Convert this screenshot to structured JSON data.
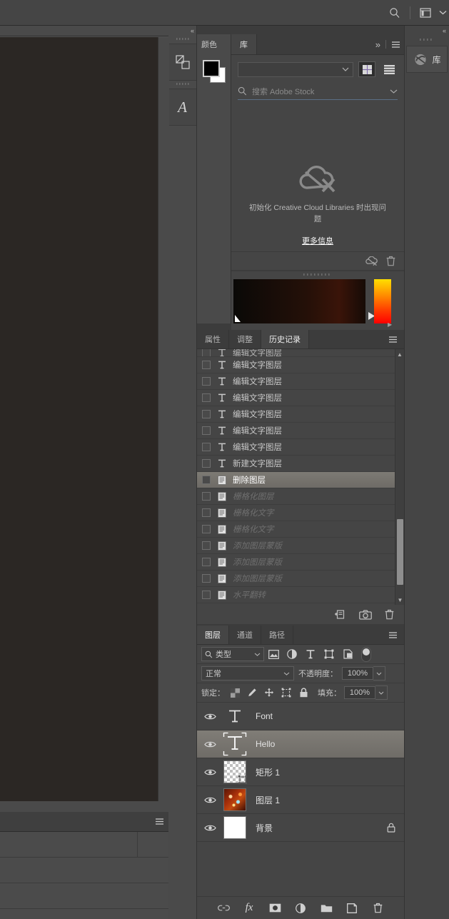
{
  "topbar": {
    "search_icon": "search-icon",
    "workspace_icon": "workspace-switcher-icon",
    "chevron": "chevron-down-icon"
  },
  "left_dock": {
    "collapse_label": "«",
    "items": [
      {
        "icon": "layer-comps-icon",
        "name": "layer-comps"
      },
      {
        "icon": "character-panel-icon",
        "name": "character-panel"
      }
    ]
  },
  "color_panel": {
    "tab_label": "颜色",
    "foreground": "#000000",
    "background": "#ffffff"
  },
  "libraries": {
    "tab_label": "库",
    "overflow_label": "»",
    "menu_icon": "panel-menu-icon",
    "dropdown_value": "",
    "grid_view_icon": "grid-view-icon",
    "list_view_icon": "list-view-icon",
    "search_placeholder": "搜索 Adobe Stock",
    "search_value": "",
    "error_icon": "cloud-error-icon",
    "error_message": "初始化 Creative Cloud Libraries 时出现问题",
    "more_info_label": "更多信息",
    "footer_icons": [
      "cloud-sync-error-icon",
      "trash-icon"
    ]
  },
  "color_picker": {
    "field_label": "color-field",
    "hue_label": "hue-slider",
    "play_icon": "play-icon"
  },
  "history": {
    "tabs": [
      {
        "label": "属性",
        "active": false
      },
      {
        "label": "调整",
        "active": false
      },
      {
        "label": "历史记录",
        "active": true
      }
    ],
    "menu_icon": "panel-menu-icon",
    "items": [
      {
        "label": "编辑文字图层",
        "icon": "text-icon",
        "state": "partial"
      },
      {
        "label": "编辑文字图层",
        "icon": "text-icon",
        "state": "normal"
      },
      {
        "label": "编辑文字图层",
        "icon": "text-icon",
        "state": "normal"
      },
      {
        "label": "编辑文字图层",
        "icon": "text-icon",
        "state": "normal"
      },
      {
        "label": "编辑文字图层",
        "icon": "text-icon",
        "state": "normal"
      },
      {
        "label": "编辑文字图层",
        "icon": "text-icon",
        "state": "normal"
      },
      {
        "label": "编辑文字图层",
        "icon": "text-icon",
        "state": "normal"
      },
      {
        "label": "新建文字图层",
        "icon": "text-icon",
        "state": "normal"
      },
      {
        "label": "删除图层",
        "icon": "doc-icon",
        "state": "selected"
      },
      {
        "label": "栅格化图层",
        "icon": "doc-icon",
        "state": "dim"
      },
      {
        "label": "栅格化文字",
        "icon": "doc-icon",
        "state": "dim"
      },
      {
        "label": "栅格化文字",
        "icon": "doc-icon",
        "state": "dim"
      },
      {
        "label": "添加图层蒙版",
        "icon": "doc-icon",
        "state": "dim"
      },
      {
        "label": "添加图层蒙版",
        "icon": "doc-icon",
        "state": "dim"
      },
      {
        "label": "添加图层蒙版",
        "icon": "doc-icon",
        "state": "dim"
      },
      {
        "label": "水平翻转",
        "icon": "doc-icon",
        "state": "dim"
      }
    ],
    "footer_icons": [
      "new-document-from-state-icon",
      "new-snapshot-icon",
      "delete-state-icon"
    ]
  },
  "layers": {
    "tabs": [
      {
        "label": "图层",
        "active": true
      },
      {
        "label": "通道",
        "active": false
      },
      {
        "label": "路径",
        "active": false
      }
    ],
    "menu_icon": "panel-menu-icon",
    "filter": {
      "search_icon": "search-icon",
      "kind_label": "类型",
      "chevron": "chevron-down-icon",
      "icons": [
        "filter-pixel-icon",
        "filter-adjustment-icon",
        "filter-type-icon",
        "filter-shape-icon",
        "filter-smartobject-icon"
      ],
      "toggle": "filter-enable-toggle"
    },
    "blend": {
      "mode_label": "正常",
      "opacity_label": "不透明度：",
      "opacity_value": "100%"
    },
    "lock": {
      "label": "锁定：",
      "icons": [
        "lock-transparency-icon",
        "lock-image-icon",
        "lock-position-icon",
        "lock-artboard-icon",
        "lock-all-icon"
      ],
      "fill_label": "填充：",
      "fill_value": "100%"
    },
    "rows": [
      {
        "name": "Font",
        "thumb": "text",
        "visible": true,
        "selected": false,
        "locked": false
      },
      {
        "name": "Hello",
        "thumb": "text-selected",
        "visible": true,
        "selected": true,
        "locked": false
      },
      {
        "name": "矩形 1",
        "thumb": "shape",
        "visible": true,
        "selected": false,
        "locked": false
      },
      {
        "name": "图层 1",
        "thumb": "image",
        "visible": true,
        "selected": false,
        "locked": false
      },
      {
        "name": "背景",
        "thumb": "white",
        "visible": true,
        "selected": false,
        "locked": true
      }
    ],
    "footer_icons": [
      "link-layers-icon",
      "layer-style-fx-icon",
      "add-mask-icon",
      "adjustment-layer-icon",
      "new-group-icon",
      "new-layer-icon",
      "delete-layer-icon"
    ]
  },
  "right_dock": {
    "collapse_label": "«",
    "items": [
      {
        "icon": "creative-cloud-icon",
        "label": "库"
      }
    ]
  },
  "bottom_left_panel": {
    "menu_icon": "panel-menu-icon"
  },
  "colors": {
    "panel_bg": "#454545",
    "app_bg": "#3c3c3c",
    "canvas_bg": "#2b2724",
    "selected_row": "#7d7a74",
    "accent_underline": "#5a6f86"
  }
}
